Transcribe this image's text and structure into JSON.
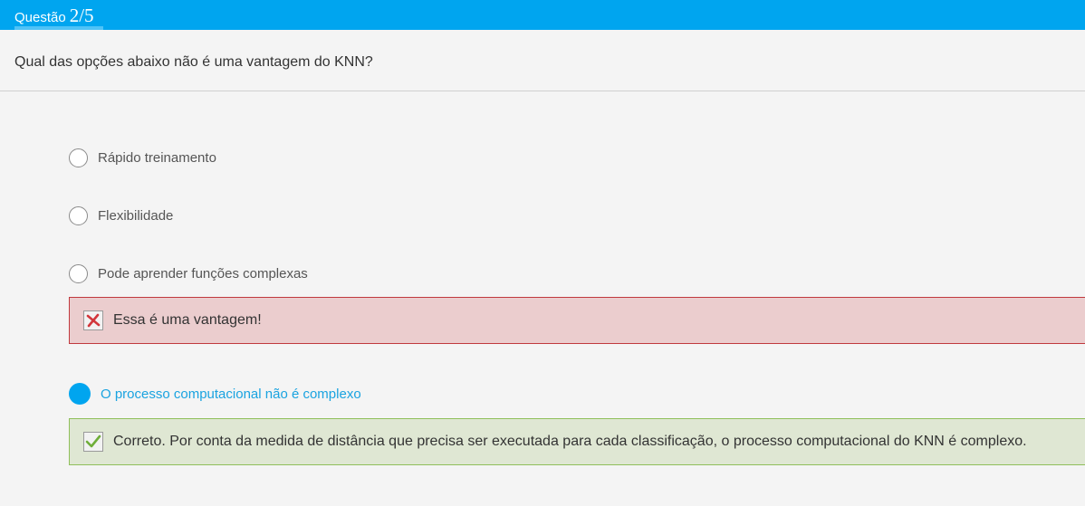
{
  "header": {
    "label": "Questão",
    "count": "2/5",
    "bar_color": "#00a5ef"
  },
  "question": {
    "text": "Qual das opções abaixo não é uma vantagem do KNN?"
  },
  "options": [
    {
      "label": "Rápido treinamento",
      "selected": false
    },
    {
      "label": "Flexibilidade",
      "selected": false
    },
    {
      "label": "Pode aprender funções complexas",
      "selected": false
    },
    {
      "label": "O processo computacional não é complexo",
      "selected": true
    }
  ],
  "feedback": {
    "wrong": {
      "icon": "x-mark-icon",
      "text": "Essa é uma vantagem!",
      "color": "#c0393e"
    },
    "correct": {
      "icon": "check-mark-icon",
      "text": "Correto. Por conta da medida de distância que precisa ser executada para cada classificação, o processo computacional do KNN é complexo.",
      "color": "#6fae3a"
    }
  },
  "colors": {
    "accent": "#00a5ef",
    "selected_text": "#1aa3e0"
  }
}
